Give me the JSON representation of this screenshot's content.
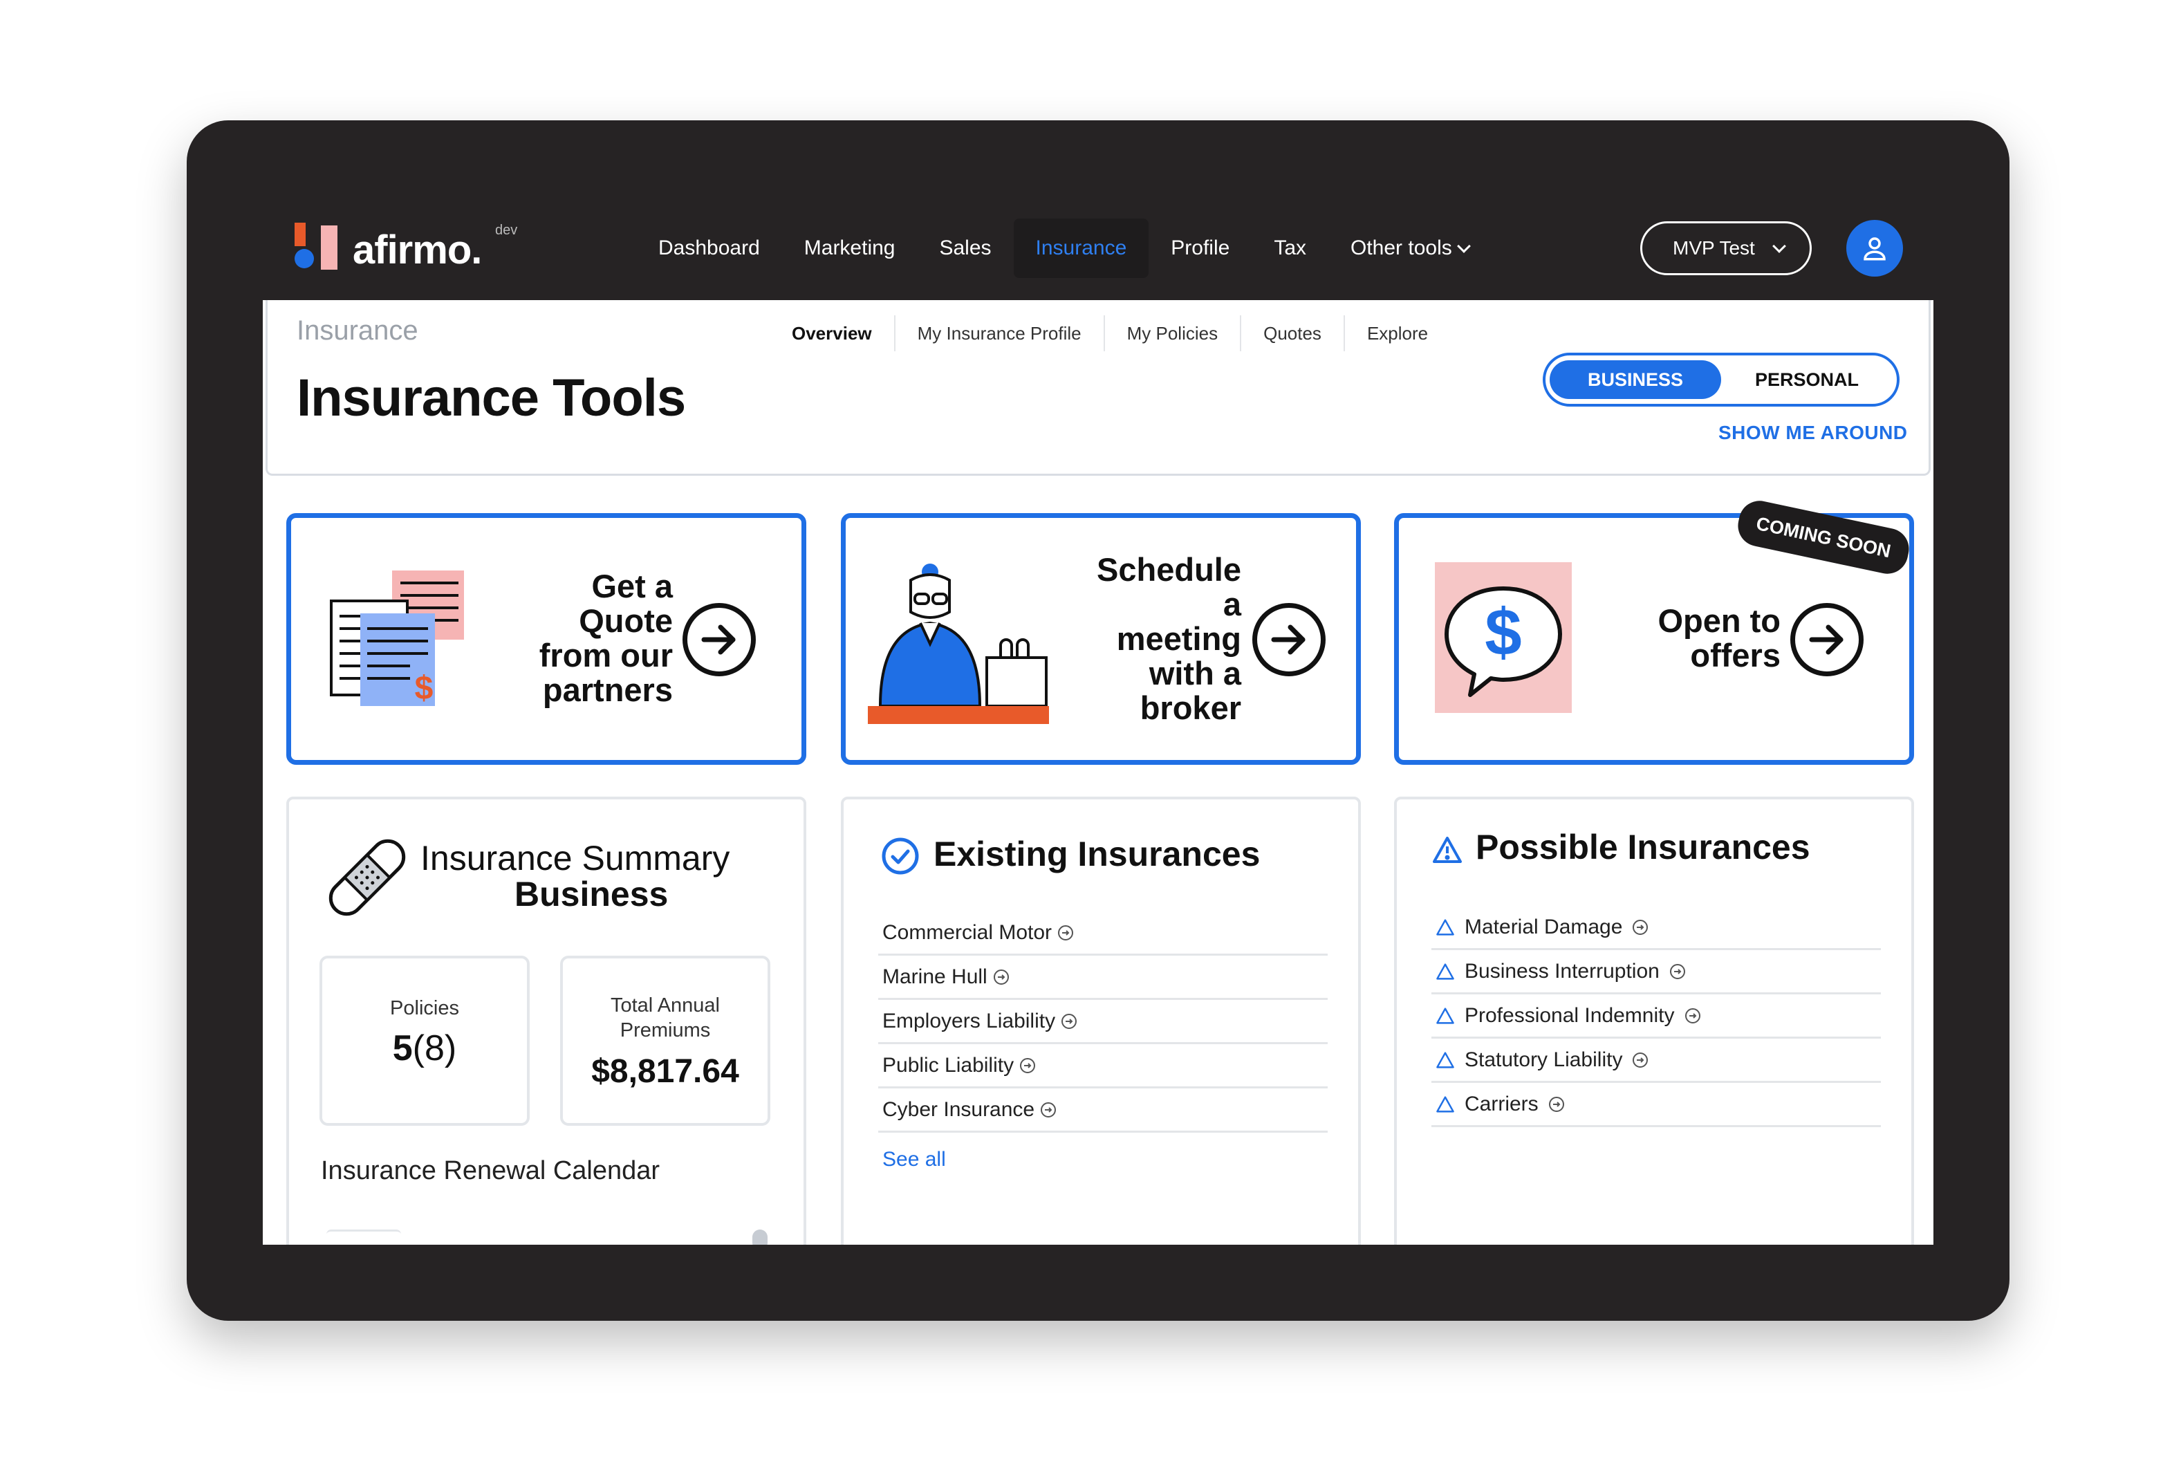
{
  "brand": {
    "name": "afirmo.",
    "env": "dev",
    "colors": {
      "accent": "#1f6fe5",
      "orange": "#e85a2a",
      "pink": "#f6b4b4",
      "dark": "#262324"
    }
  },
  "nav": {
    "items": [
      {
        "label": "Dashboard",
        "active": false
      },
      {
        "label": "Marketing",
        "active": false
      },
      {
        "label": "Sales",
        "active": false
      },
      {
        "label": "Insurance",
        "active": true
      },
      {
        "label": "Profile",
        "active": false
      },
      {
        "label": "Tax",
        "active": false
      },
      {
        "label": "Other tools",
        "active": false
      }
    ],
    "account": "MVP Test",
    "avatar_icon": "user-icon"
  },
  "page": {
    "breadcrumb": "Insurance",
    "title": "Insurance Tools",
    "tabs": [
      "Overview",
      "My Insurance Profile",
      "My Policies",
      "Quotes",
      "Explore"
    ],
    "active_tab": "Overview",
    "toggle": {
      "options": [
        "BUSINESS",
        "PERSONAL"
      ],
      "selected": "BUSINESS"
    },
    "tour_link": "SHOW ME AROUND"
  },
  "actions": [
    {
      "lines": [
        "Get a",
        "Quote",
        "from our",
        "partners"
      ],
      "icon": "quote-documents-icon"
    },
    {
      "lines": [
        "Schedule",
        "a",
        "meeting",
        "with a",
        "broker"
      ],
      "icon": "broker-meeting-icon"
    },
    {
      "lines": [
        "Open to",
        "offers"
      ],
      "icon": "dollar-speech-bubble-icon",
      "badge": "COMING SOON"
    }
  ],
  "summary": {
    "title": "Insurance Summary",
    "subtitle": "Business",
    "policies_label": "Policies",
    "policies_value": "5",
    "policies_total": "(8)",
    "premiums_label": "Total Annual Premiums",
    "premiums_value": "$8,817.64",
    "calendar_label": "Insurance Renewal Calendar"
  },
  "existing": {
    "title": "Existing Insurances",
    "items": [
      "Commercial Motor",
      "Marine Hull",
      "Employers Liability",
      "Public Liability",
      "Cyber Insurance"
    ],
    "see_all": "See all"
  },
  "possible": {
    "title": "Possible Insurances",
    "items": [
      "Material Damage",
      "Business Interruption",
      "Professional Indemnity",
      "Statutory Liability",
      "Carriers"
    ]
  }
}
